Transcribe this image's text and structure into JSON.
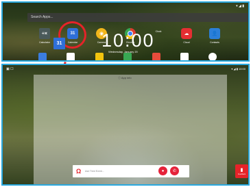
{
  "drawer": {
    "search_placeholder": "Search Apps...",
    "status": "▾ ◢ ▮",
    "apps": [
      {
        "label": "Calculator",
        "icon": "calculator-icon",
        "glyph": "÷×"
      },
      {
        "label": "Calendar",
        "icon": "calendar-icon",
        "glyph": "31"
      },
      {
        "label": "Camera",
        "icon": "camera-icon",
        "glyph": "◉"
      },
      {
        "label": "Chrome",
        "icon": "chrome-icon",
        "glyph": ""
      },
      {
        "label": "Clock",
        "icon": "clock-icon",
        "glyph": ""
      },
      {
        "label": "Cloud",
        "icon": "cloud-icon",
        "glyph": "☁"
      },
      {
        "label": "Contacts",
        "icon": "contacts-icon",
        "glyph": "👤"
      }
    ],
    "highlight_color": "#e52329"
  },
  "home": {
    "app_info": "ⓘ  App info",
    "status_left": "▣ ☐",
    "status_right": "▾ ◢ ▮ 10:00",
    "calendar_glyph": "31",
    "time": "10:00",
    "date": "Wednesday, January 20",
    "ask_text": "Ask Third Event...",
    "feedback_label": "Feedback"
  },
  "colors": {
    "panel_border": "#29a9e0",
    "accent_red": "#e52329"
  }
}
